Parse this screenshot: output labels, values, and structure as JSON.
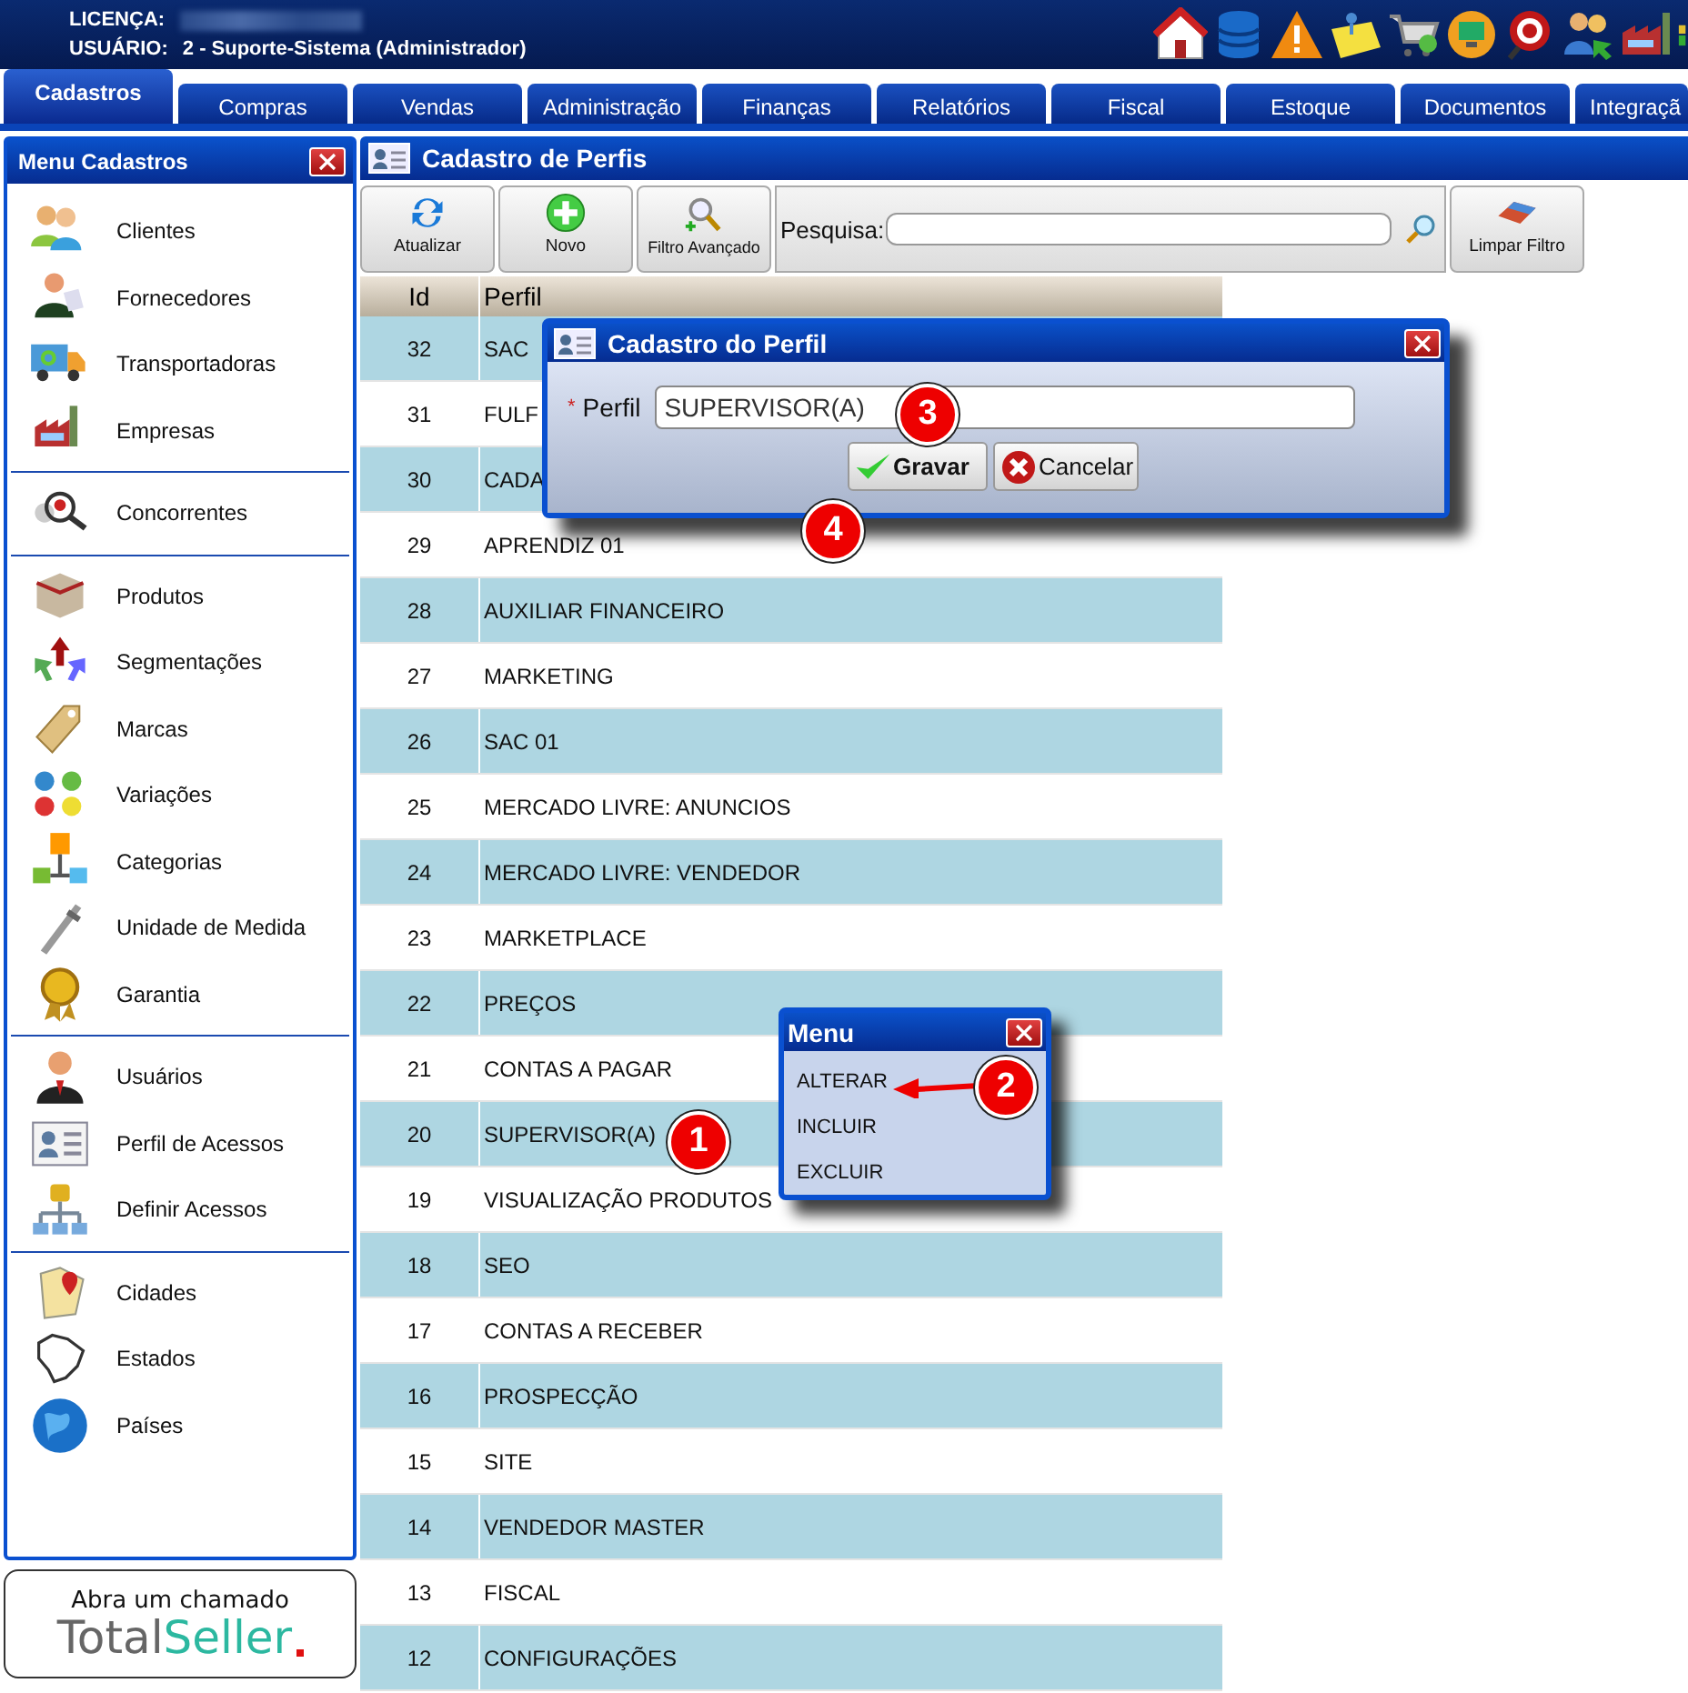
{
  "header": {
    "license_label": "LICENÇA:",
    "user_label": "USUÁRIO:",
    "user_value": "2 - Suporte-Sistema (Administrador)"
  },
  "tabs": [
    {
      "label": "Cadastros",
      "selected": true
    },
    {
      "label": "Compras",
      "selected": false
    },
    {
      "label": "Vendas",
      "selected": false
    },
    {
      "label": "Administração",
      "selected": false
    },
    {
      "label": "Finanças",
      "selected": false
    },
    {
      "label": "Relatórios",
      "selected": false
    },
    {
      "label": "Fiscal",
      "selected": false
    },
    {
      "label": "Estoque",
      "selected": false
    },
    {
      "label": "Documentos",
      "selected": false
    },
    {
      "label": "Integraçã",
      "selected": false
    }
  ],
  "sidebar": {
    "title": "Menu Cadastros",
    "groups": [
      {
        "items": [
          "Clientes",
          "Fornecedores",
          "Transportadoras",
          "Empresas"
        ]
      },
      {
        "items": [
          "Concorrentes"
        ]
      },
      {
        "items": [
          "Produtos",
          "Segmentações",
          "Marcas",
          "Variações",
          "Categorias",
          "Unidade de Medida",
          "Garantia"
        ]
      },
      {
        "items": [
          "Usuários",
          "Perfil de Acessos",
          "Definir Acessos"
        ]
      },
      {
        "items": [
          "Cidades",
          "Estados",
          "Países"
        ]
      }
    ]
  },
  "support": {
    "text": "Abra um chamado",
    "logo_a": "Total",
    "logo_b": "Seller"
  },
  "panel": {
    "title": "Cadastro de Perfis"
  },
  "toolbar": {
    "buttons": [
      "Atualizar",
      "Novo",
      "Filtro Avançado"
    ],
    "search_label": "Pesquisa:",
    "clear_button": "Limpar Filtro"
  },
  "table": {
    "columns": [
      "Id",
      "Perfil"
    ],
    "rows": [
      {
        "id": "32",
        "perfil": "SAC"
      },
      {
        "id": "31",
        "perfil": "FULF"
      },
      {
        "id": "30",
        "perfil": "CADA"
      },
      {
        "id": "29",
        "perfil": "APRENDIZ 01"
      },
      {
        "id": "28",
        "perfil": "AUXILIAR FINANCEIRO"
      },
      {
        "id": "27",
        "perfil": "MARKETING"
      },
      {
        "id": "26",
        "perfil": "SAC 01"
      },
      {
        "id": "25",
        "perfil": "MERCADO LIVRE: ANUNCIOS"
      },
      {
        "id": "24",
        "perfil": "MERCADO LIVRE: VENDEDOR"
      },
      {
        "id": "23",
        "perfil": "MARKETPLACE"
      },
      {
        "id": "22",
        "perfil": "PREÇOS"
      },
      {
        "id": "21",
        "perfil": "CONTAS A PAGAR"
      },
      {
        "id": "20",
        "perfil": "SUPERVISOR(A)"
      },
      {
        "id": "19",
        "perfil": "VISUALIZAÇÃO PRODUTOS"
      },
      {
        "id": "18",
        "perfil": "SEO"
      },
      {
        "id": "17",
        "perfil": "CONTAS A RECEBER"
      },
      {
        "id": "16",
        "perfil": "PROSPECÇÃO"
      },
      {
        "id": "15",
        "perfil": "SITE"
      },
      {
        "id": "14",
        "perfil": "VENDEDOR MASTER"
      },
      {
        "id": "13",
        "perfil": "FISCAL"
      },
      {
        "id": "12",
        "perfil": "CONFIGURAÇÕES"
      }
    ]
  },
  "dialog": {
    "title": "Cadastro do Perfil",
    "required_mark": "*",
    "field_label": "Perfil",
    "field_value": "SUPERVISOR(A)",
    "buttons": [
      "Gravar",
      "Cancelar"
    ]
  },
  "context_menu": {
    "title": "Menu",
    "items": [
      "ALTERAR",
      "INCLUIR",
      "EXCLUIR"
    ]
  },
  "annotations": [
    {
      "label": "1"
    },
    {
      "label": "2"
    },
    {
      "label": "3"
    },
    {
      "label": "4"
    }
  ]
}
